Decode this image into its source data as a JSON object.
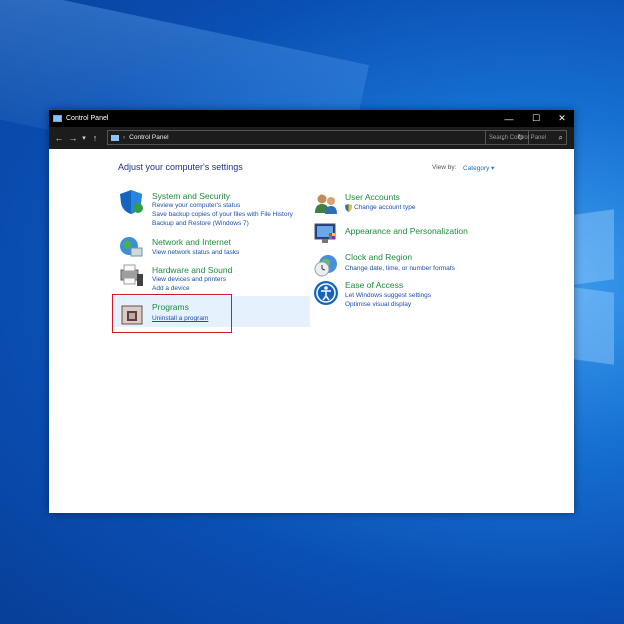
{
  "window": {
    "title": "Control Panel",
    "controls": {
      "minimize": "—",
      "maximize": "☐",
      "close": "✕"
    }
  },
  "addressbar": {
    "back": "←",
    "forward": "→",
    "recent": "▾",
    "up": "↑",
    "separator": "›",
    "path": "Control Panel",
    "dropdown": "⌄",
    "refresh": "↻",
    "search_placeholder": "Search Control Panel",
    "search_icon": "⌕"
  },
  "content": {
    "heading": "Adjust your computer's settings",
    "view_by_label": "View by:",
    "view_by_value": "Category ▾",
    "categories": [
      {
        "title": "System and Security",
        "links": [
          "Review your computer's status",
          "Save backup copies of your files with File History",
          "Backup and Restore (Windows 7)"
        ],
        "icon": "shield-icon"
      },
      {
        "title": "Network and Internet",
        "links": [
          "View network status and tasks"
        ],
        "icon": "network-globe-icon"
      },
      {
        "title": "Hardware and Sound",
        "links": [
          "View devices and printers",
          "Add a device"
        ],
        "icon": "printer-speaker-icon"
      },
      {
        "title": "Programs",
        "links": [
          "Uninstall a program"
        ],
        "icon": "programs-box-icon"
      },
      {
        "title": "User Accounts",
        "links": [
          "Change account type"
        ],
        "icon": "users-icon"
      },
      {
        "title": "Appearance and Personalization",
        "links": [],
        "icon": "monitor-palette-icon"
      },
      {
        "title": "Clock and Region",
        "links": [
          "Change date, time, or number formats"
        ],
        "icon": "clock-globe-icon"
      },
      {
        "title": "Ease of Access",
        "links": [
          "Let Windows suggest settings",
          "Optimise visual display"
        ],
        "icon": "ease-of-access-icon"
      }
    ]
  },
  "colors": {
    "heading": "#1e3287",
    "category_title": "#1e8a3c",
    "link": "#1a4fae",
    "highlight": "#e5f2fd",
    "red_outline": "#d41a2a"
  }
}
